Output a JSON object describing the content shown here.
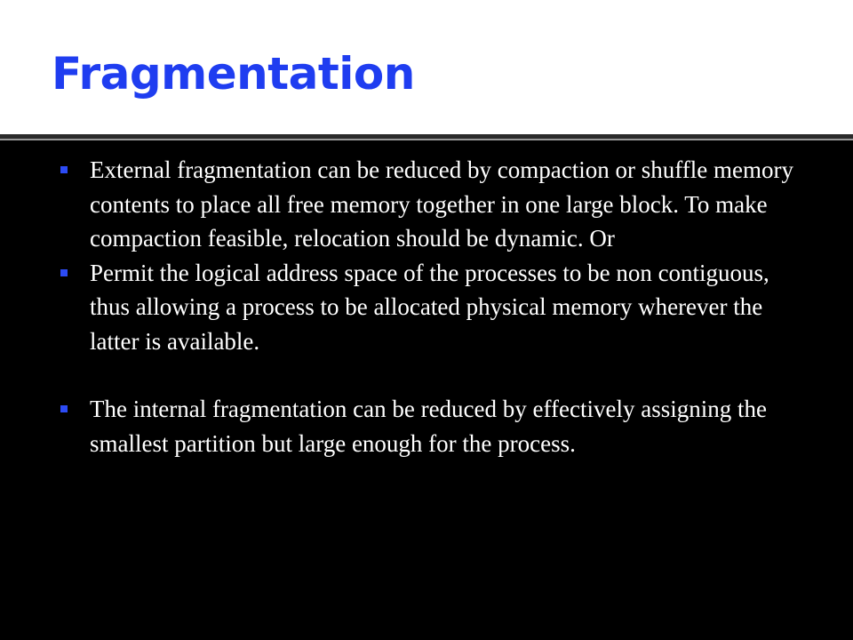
{
  "slide": {
    "title": "Fragmentation",
    "colors": {
      "title": "#1f3df0",
      "bullet_marker": "#2c4bf5",
      "background": "#000000",
      "title_band": "#ffffff",
      "text": "#ffffff"
    },
    "bullets": [
      {
        "text": "External fragmentation can be reduced by compaction or shuffle memory contents to place all free memory together in one large block. To make compaction feasible, relocation should be dynamic. Or"
      },
      {
        "text": "Permit the logical address space of the processes to be non contiguous, thus allowing a process to be allocated physical memory wherever the latter is available."
      },
      {
        "text": "The internal fragmentation can be reduced by effectively assigning the smallest partition but large enough for the process."
      }
    ]
  }
}
